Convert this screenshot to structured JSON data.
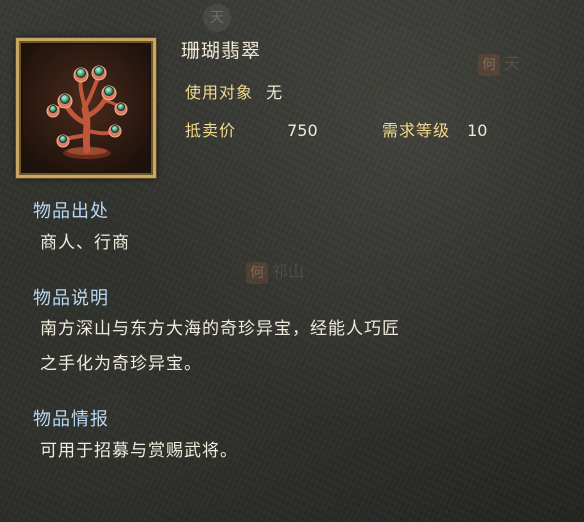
{
  "item": {
    "name": "珊瑚翡翠",
    "icon": "coral-jade-icon"
  },
  "stats": {
    "target_label": "使用对象",
    "target_value": "无",
    "price_label": "抵卖价",
    "price_value": "750",
    "level_label": "需求等级",
    "level_value": "10"
  },
  "sections": {
    "origin_heading": "物品出处",
    "origin_text": "商人、行商",
    "desc_heading": "物品说明",
    "desc_line1": "南方深山与东方大海的奇珍异宝，经能人巧匠",
    "desc_line2": "之手化为奇珍异宝。",
    "info_heading": "物品情报",
    "info_text": "可用于招募与赏赐武将。"
  },
  "background": {
    "mark1_seal": "何",
    "mark1_text": "天",
    "mark2_seal": "何",
    "mark2_text": "祁山",
    "circle_text": "天"
  },
  "colors": {
    "label": "#f3d98a",
    "heading": "#b9d8f2",
    "frame": "#c8a866"
  }
}
